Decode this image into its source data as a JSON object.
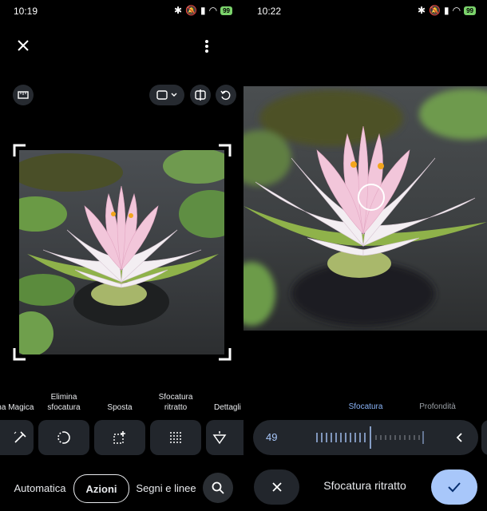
{
  "left": {
    "status": {
      "time": "10:19",
      "battery": "99"
    },
    "tools": [
      {
        "label": "ma Magica",
        "icon": "magic-eraser-icon"
      },
      {
        "label": "Elimina sfocatura",
        "icon": "unblur-icon"
      },
      {
        "label": "Sposta",
        "icon": "move-icon"
      },
      {
        "label": "Sfocatura ritratto",
        "icon": "portrait-blur-icon"
      },
      {
        "label": "Dettagli",
        "icon": "details-icon"
      }
    ],
    "tabs": {
      "auto": "Automatica",
      "actions": "Azioni",
      "marks": "Segni e linee"
    }
  },
  "right": {
    "status": {
      "time": "10:22",
      "battery": "99"
    },
    "modes": {
      "blur": "Sfocatura",
      "depth": "Profondità"
    },
    "slider": {
      "value": "49",
      "level": 0.49
    },
    "title": "Sfocatura ritratto"
  },
  "colors": {
    "accent": "#a8c7fa",
    "active_blue": "#8ab4f8",
    "battery": "#7bd36b"
  }
}
